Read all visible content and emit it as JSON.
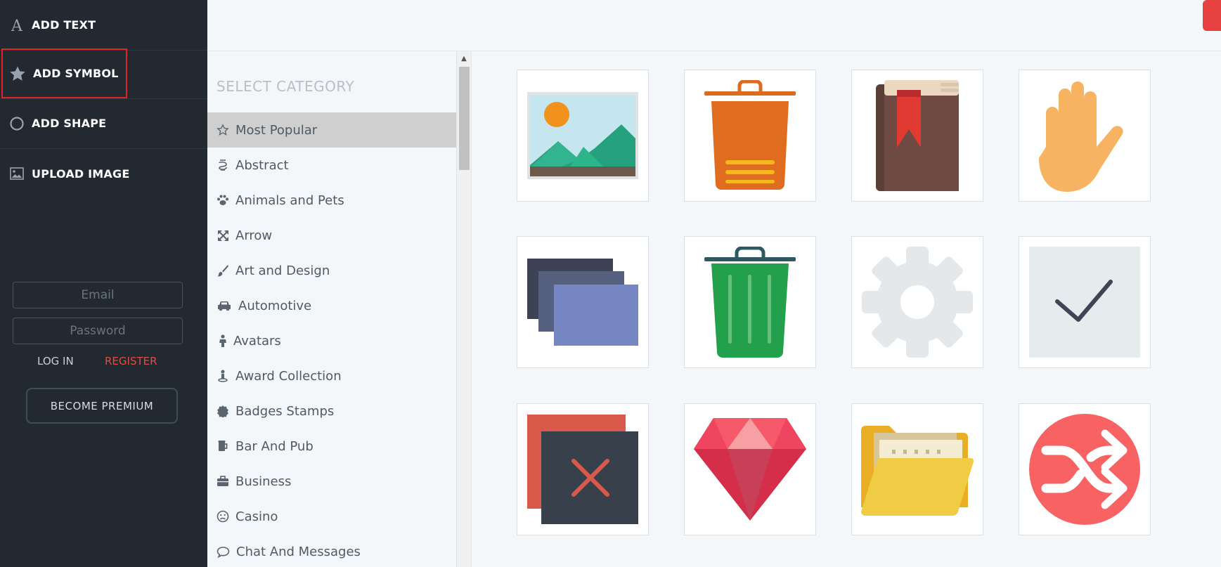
{
  "sidebar": {
    "tools": [
      {
        "label": "ADD TEXT",
        "icon": "text-icon"
      },
      {
        "label": "ADD SYMBOL",
        "icon": "star-icon"
      },
      {
        "label": "ADD SHAPE",
        "icon": "circle-icon"
      },
      {
        "label": "UPLOAD IMAGE",
        "icon": "image-icon"
      }
    ],
    "email_placeholder": "Email",
    "password_placeholder": "Password",
    "login_label": "LOG IN",
    "register_label": "REGISTER",
    "premium_label": "BECOME PREMIUM"
  },
  "category_panel": {
    "title": "SELECT CATEGORY",
    "categories": [
      {
        "label": "Most Popular",
        "icon": "star-outline-icon",
        "selected": true
      },
      {
        "label": "Abstract",
        "icon": "abstract-icon"
      },
      {
        "label": "Animals and Pets",
        "icon": "paw-icon"
      },
      {
        "label": "Arrow",
        "icon": "arrows-expand-icon"
      },
      {
        "label": "Art and Design",
        "icon": "brush-icon"
      },
      {
        "label": "Automotive",
        "icon": "car-icon"
      },
      {
        "label": "Avatars",
        "icon": "person-icon"
      },
      {
        "label": "Award Collection",
        "icon": "award-icon"
      },
      {
        "label": "Badges Stamps",
        "icon": "badge-icon"
      },
      {
        "label": "Bar And Pub",
        "icon": "beer-icon"
      },
      {
        "label": "Business",
        "icon": "briefcase-icon"
      },
      {
        "label": "Casino",
        "icon": "frown-face-icon"
      },
      {
        "label": "Chat And Messages",
        "icon": "chat-bubble-icon"
      }
    ]
  },
  "symbols": [
    {
      "name": "landscape-picture-icon"
    },
    {
      "name": "orange-trash-can-icon"
    },
    {
      "name": "bookmarked-book-icon"
    },
    {
      "name": "raised-hand-icon"
    },
    {
      "name": "stacked-windows-icon"
    },
    {
      "name": "green-trash-can-icon"
    },
    {
      "name": "gear-icon"
    },
    {
      "name": "checkmark-box-icon"
    },
    {
      "name": "close-window-icon"
    },
    {
      "name": "ruby-gem-icon"
    },
    {
      "name": "open-folder-icon"
    },
    {
      "name": "shuffle-icon"
    }
  ],
  "colors": {
    "sidebar_bg": "#222931",
    "accent_red": "#e84141",
    "register_red": "#e84a3c",
    "selected_category_bg": "#cfcfcf"
  }
}
